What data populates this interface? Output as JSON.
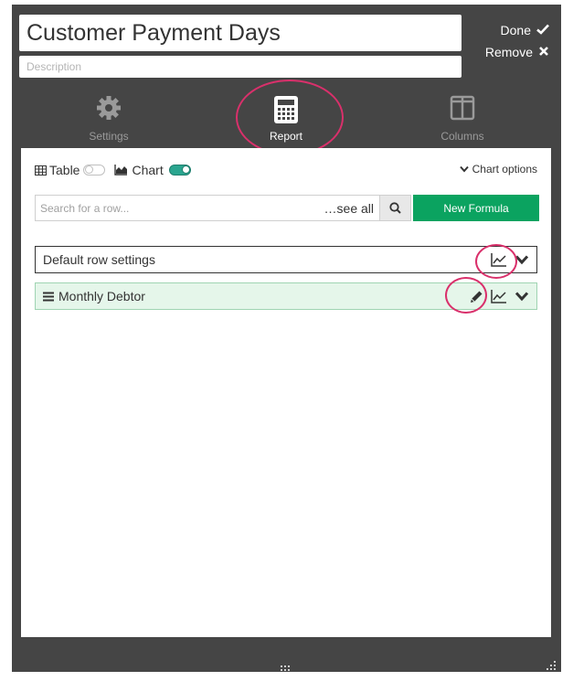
{
  "header": {
    "title": "Customer Payment Days",
    "description_placeholder": "Description",
    "done_label": "Done",
    "remove_label": "Remove"
  },
  "tabs": [
    {
      "label": "Settings",
      "icon": "gear-icon"
    },
    {
      "label": "Report",
      "icon": "calculator-icon",
      "active": true
    },
    {
      "label": "Columns",
      "icon": "columns-icon"
    }
  ],
  "view_toggles": {
    "table_label": "Table",
    "table_on": false,
    "chart_label": "Chart",
    "chart_on": true,
    "chart_options_label": "Chart options"
  },
  "search": {
    "placeholder": "Search for a row...",
    "see_all_label": "…see all",
    "new_formula_label": "New Formula"
  },
  "rows": [
    {
      "label": "Default row settings"
    },
    {
      "label": "Monthly Debtor"
    }
  ],
  "colors": {
    "panel": "#454545",
    "accent_green": "#0ba360",
    "toggle_on": "#2aa58f",
    "highlight": "#d9306b",
    "row_selected_bg": "#e5f6ea"
  }
}
